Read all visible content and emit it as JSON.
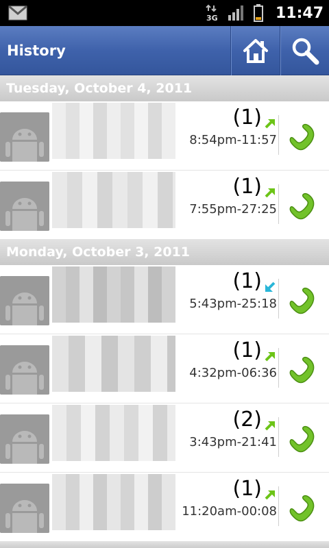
{
  "status_bar": {
    "time": "11:47",
    "network": "3G",
    "icons": [
      "gmail-icon",
      "data-arrows-icon",
      "signal-icon",
      "battery-icon"
    ]
  },
  "title_bar": {
    "title": "History",
    "buttons": [
      "home-icon",
      "search-icon"
    ]
  },
  "sections": [
    {
      "date": "Tuesday, October 4, 2011",
      "entries": [
        {
          "count": "(1)",
          "direction": "outgoing",
          "time": "8:54pm-11:57"
        },
        {
          "count": "(1)",
          "direction": "outgoing",
          "time": "7:55pm-27:25"
        }
      ]
    },
    {
      "date": "Monday, October 3, 2011",
      "entries": [
        {
          "count": "(1)",
          "direction": "incoming",
          "time": "5:43pm-25:18"
        },
        {
          "count": "(1)",
          "direction": "outgoing",
          "time": "4:32pm-06:36"
        },
        {
          "count": "(2)",
          "direction": "outgoing",
          "time": "3:43pm-21:41"
        },
        {
          "count": "(1)",
          "direction": "outgoing",
          "time": "11:20am-00:08"
        }
      ]
    }
  ],
  "colors": {
    "title_bar": "#3f62ab",
    "outgoing_arrow": "#6cc417",
    "incoming_arrow": "#29b6d8",
    "call_green": "#72c22a"
  }
}
